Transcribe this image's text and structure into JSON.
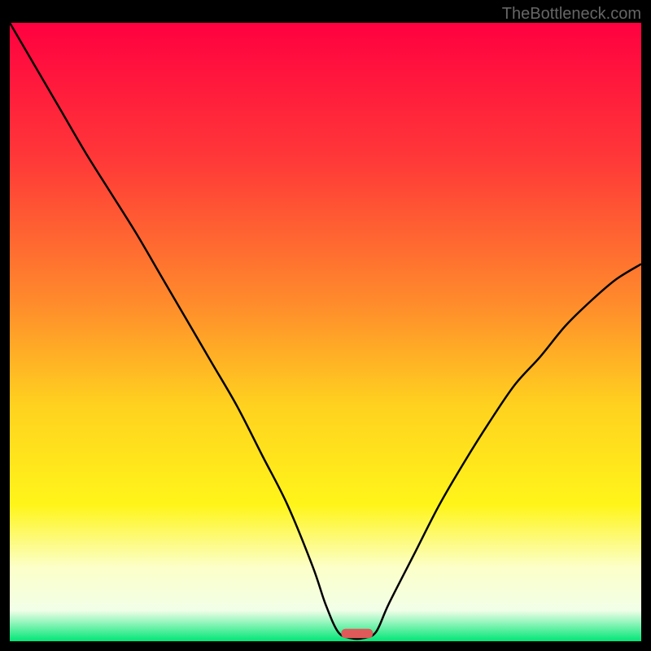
{
  "watermark": "TheBottleneck.com",
  "chart_data": {
    "type": "line",
    "title": "",
    "xlabel": "",
    "ylabel": "",
    "xlim": [
      0,
      100
    ],
    "ylim": [
      0,
      100
    ],
    "gradient_stops": [
      {
        "offset": 0,
        "color": "#ff0040"
      },
      {
        "offset": 22,
        "color": "#ff3838"
      },
      {
        "offset": 45,
        "color": "#ff8a2c"
      },
      {
        "offset": 62,
        "color": "#ffd21f"
      },
      {
        "offset": 78,
        "color": "#fff51a"
      },
      {
        "offset": 88,
        "color": "#fcffc8"
      },
      {
        "offset": 95,
        "color": "#f2ffe8"
      },
      {
        "offset": 100,
        "color": "#00e676"
      }
    ],
    "series": [
      {
        "name": "bottleneck-curve",
        "color": "#000000",
        "x": [
          0,
          4,
          8,
          12,
          16,
          20,
          24,
          28,
          32,
          36,
          40,
          44,
          48,
          50,
          52,
          54,
          56,
          58,
          60,
          64,
          68,
          72,
          76,
          80,
          84,
          88,
          92,
          96,
          100
        ],
        "values": [
          100,
          93,
          86,
          79,
          72.5,
          66,
          59,
          52,
          45,
          38,
          30,
          22,
          12,
          6,
          1.5,
          0.5,
          0.5,
          1.5,
          6,
          14,
          22,
          29,
          35.5,
          41.5,
          46,
          51,
          55,
          58.5,
          61
        ]
      }
    ],
    "marker": {
      "x": 55,
      "y": 0.5,
      "width": 5,
      "height": 1.5,
      "color": "#e05a5a"
    }
  }
}
